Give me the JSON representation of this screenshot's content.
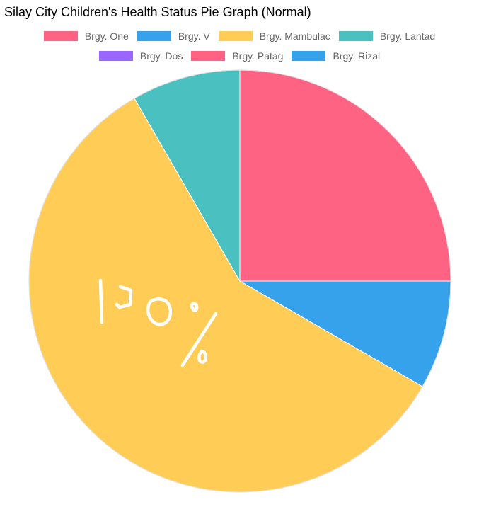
{
  "page": {
    "title": "Silay City Children's Health Status Pie Graph (Normal)"
  },
  "chart_data": {
    "type": "pie",
    "title": "Silay City Children's Health Status Pie Graph (Normal)",
    "legend_position": "top",
    "categories": [
      "Brgy. One",
      "Brgy. V",
      "Brgy. Mambulac",
      "Brgy. Lantad",
      "Brgy. Dos",
      "Brgy. Patag",
      "Brgy. Rizal"
    ],
    "values": [
      3,
      1,
      7,
      1,
      0,
      0,
      0
    ],
    "colors": [
      "#ff6384",
      "#36a2eb",
      "#ffcd56",
      "#4bc0c0",
      "#9966ff",
      "#ff6384",
      "#36a2eb"
    ],
    "annotation": "100%"
  }
}
